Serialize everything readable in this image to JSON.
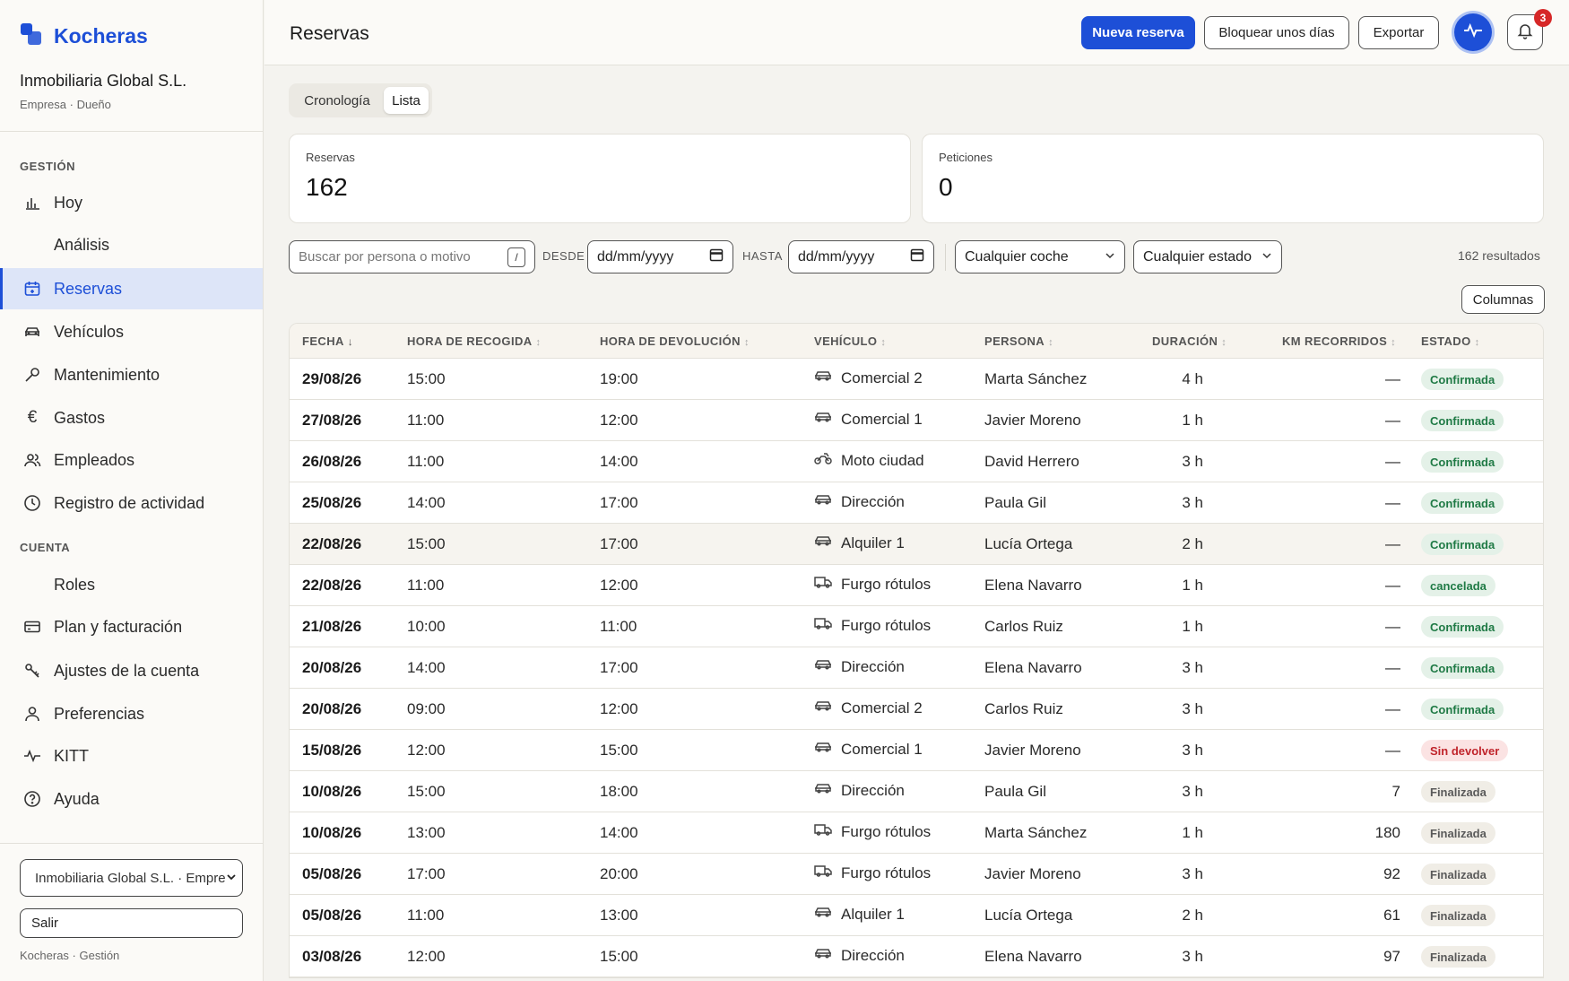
{
  "app": {
    "brand": "Kocheras",
    "accent": "#1d4fd7"
  },
  "org": {
    "name": "Inmobiliaria Global S.L.",
    "sub": "Empresa · Dueño"
  },
  "sidebar": {
    "section_gestion": "GESTIÓN",
    "section_cuenta": "CUENTA",
    "items": [
      {
        "label": "Hoy",
        "icon": "bar-chart-icon"
      },
      {
        "label": "Análisis",
        "icon": ""
      },
      {
        "label": "Reservas",
        "icon": "calendar-icon"
      },
      {
        "label": "Vehículos",
        "icon": "car-icon"
      },
      {
        "label": "Mantenimiento",
        "icon": "wrench-icon"
      },
      {
        "label": "Gastos",
        "icon": "euro-icon"
      },
      {
        "label": "Empleados",
        "icon": "users-icon"
      },
      {
        "label": "Registro de actividad",
        "icon": "clock-icon"
      },
      {
        "label": "Roles",
        "icon": ""
      },
      {
        "label": "Plan y facturación",
        "icon": "credit-card-icon"
      },
      {
        "label": "Ajustes de la cuenta",
        "icon": "key-icon"
      },
      {
        "label": "Preferencias",
        "icon": "user-icon"
      },
      {
        "label": "KITT",
        "icon": "pulse-icon"
      },
      {
        "label": "Ayuda",
        "icon": "help-icon"
      }
    ],
    "org_select": "Inmobiliaria Global S.L. · Empre",
    "logout": "Salir",
    "footer": "Kocheras · Gestión"
  },
  "header": {
    "title": "Reservas",
    "new_booking": "Nueva reserva",
    "block_days": "Bloquear unos días",
    "export": "Exportar",
    "notifications_count": "3"
  },
  "tabs": [
    "Cronología",
    "Lista"
  ],
  "stats": {
    "bookings_label": "Reservas",
    "bookings_value": "162",
    "requests_label": "Peticiones",
    "requests_value": "0"
  },
  "filters": {
    "search_placeholder": "Buscar por persona o motivo",
    "search_shortcut": "/",
    "from_label": "DESDE",
    "to_label": "HASTA",
    "date_placeholder": "dd/mm/yyyy",
    "car": "Cualquier coche",
    "status": "Cualquier estado",
    "results": "162 resultados",
    "columns": "Columnas"
  },
  "table": {
    "headers": [
      "FECHA",
      "HORA DE RECOGIDA",
      "HORA DE DEVOLUCIÓN",
      "VEHÍCULO",
      "PERSONA",
      "DURACIÓN",
      "KM RECORRIDOS",
      "ESTADO"
    ],
    "sort_active": "↓",
    "sort_idle": "↕",
    "rows": [
      {
        "date": "29/08/26",
        "pickup": "15:00",
        "return": "19:00",
        "vehicle": "Comercial 2",
        "vtype": "car",
        "person": "Marta Sánchez",
        "duration": "4 h",
        "km": "—",
        "status": "Confirmada",
        "kind": "ok"
      },
      {
        "date": "27/08/26",
        "pickup": "11:00",
        "return": "12:00",
        "vehicle": "Comercial 1",
        "vtype": "car",
        "person": "Javier Moreno",
        "duration": "1 h",
        "km": "—",
        "status": "Confirmada",
        "kind": "ok"
      },
      {
        "date": "26/08/26",
        "pickup": "11:00",
        "return": "14:00",
        "vehicle": "Moto ciudad",
        "vtype": "moto",
        "person": "David Herrero",
        "duration": "3 h",
        "km": "—",
        "status": "Confirmada",
        "kind": "ok"
      },
      {
        "date": "25/08/26",
        "pickup": "14:00",
        "return": "17:00",
        "vehicle": "Dirección",
        "vtype": "car",
        "person": "Paula Gil",
        "duration": "3 h",
        "km": "—",
        "status": "Confirmada",
        "kind": "ok"
      },
      {
        "date": "22/08/26",
        "pickup": "15:00",
        "return": "17:00",
        "vehicle": "Alquiler 1",
        "vtype": "car",
        "person": "Lucía Ortega",
        "duration": "2 h",
        "km": "—",
        "status": "Confirmada",
        "kind": "ok"
      },
      {
        "date": "22/08/26",
        "pickup": "11:00",
        "return": "12:00",
        "vehicle": "Furgo rótulos",
        "vtype": "van",
        "person": "Elena Navarro",
        "duration": "1 h",
        "km": "—",
        "status": "cancelada",
        "kind": "cancel"
      },
      {
        "date": "21/08/26",
        "pickup": "10:00",
        "return": "11:00",
        "vehicle": "Furgo rótulos",
        "vtype": "van",
        "person": "Carlos Ruiz",
        "duration": "1 h",
        "km": "—",
        "status": "Confirmada",
        "kind": "ok"
      },
      {
        "date": "20/08/26",
        "pickup": "14:00",
        "return": "17:00",
        "vehicle": "Dirección",
        "vtype": "car",
        "person": "Elena Navarro",
        "duration": "3 h",
        "km": "—",
        "status": "Confirmada",
        "kind": "ok"
      },
      {
        "date": "20/08/26",
        "pickup": "09:00",
        "return": "12:00",
        "vehicle": "Comercial 2",
        "vtype": "car",
        "person": "Carlos Ruiz",
        "duration": "3 h",
        "km": "—",
        "status": "Confirmada",
        "kind": "ok"
      },
      {
        "date": "15/08/26",
        "pickup": "12:00",
        "return": "15:00",
        "vehicle": "Comercial 1",
        "vtype": "car",
        "person": "Javier Moreno",
        "duration": "3 h",
        "km": "—",
        "status": "Sin devolver",
        "kind": "bad"
      },
      {
        "date": "10/08/26",
        "pickup": "15:00",
        "return": "18:00",
        "vehicle": "Dirección",
        "vtype": "car",
        "person": "Paula Gil",
        "duration": "3 h",
        "km": "7",
        "status": "Finalizada",
        "kind": "done"
      },
      {
        "date": "10/08/26",
        "pickup": "13:00",
        "return": "14:00",
        "vehicle": "Furgo rótulos",
        "vtype": "van",
        "person": "Marta Sánchez",
        "duration": "1 h",
        "km": "180",
        "status": "Finalizada",
        "kind": "done"
      },
      {
        "date": "05/08/26",
        "pickup": "17:00",
        "return": "20:00",
        "vehicle": "Furgo rótulos",
        "vtype": "van",
        "person": "Javier Moreno",
        "duration": "3 h",
        "km": "92",
        "status": "Finalizada",
        "kind": "done"
      },
      {
        "date": "05/08/26",
        "pickup": "11:00",
        "return": "13:00",
        "vehicle": "Alquiler 1",
        "vtype": "car",
        "person": "Lucía Ortega",
        "duration": "2 h",
        "km": "61",
        "status": "Finalizada",
        "kind": "done"
      },
      {
        "date": "03/08/26",
        "pickup": "12:00",
        "return": "15:00",
        "vehicle": "Dirección",
        "vtype": "car",
        "person": "Elena Navarro",
        "duration": "3 h",
        "km": "97",
        "status": "Finalizada",
        "kind": "done"
      }
    ]
  }
}
